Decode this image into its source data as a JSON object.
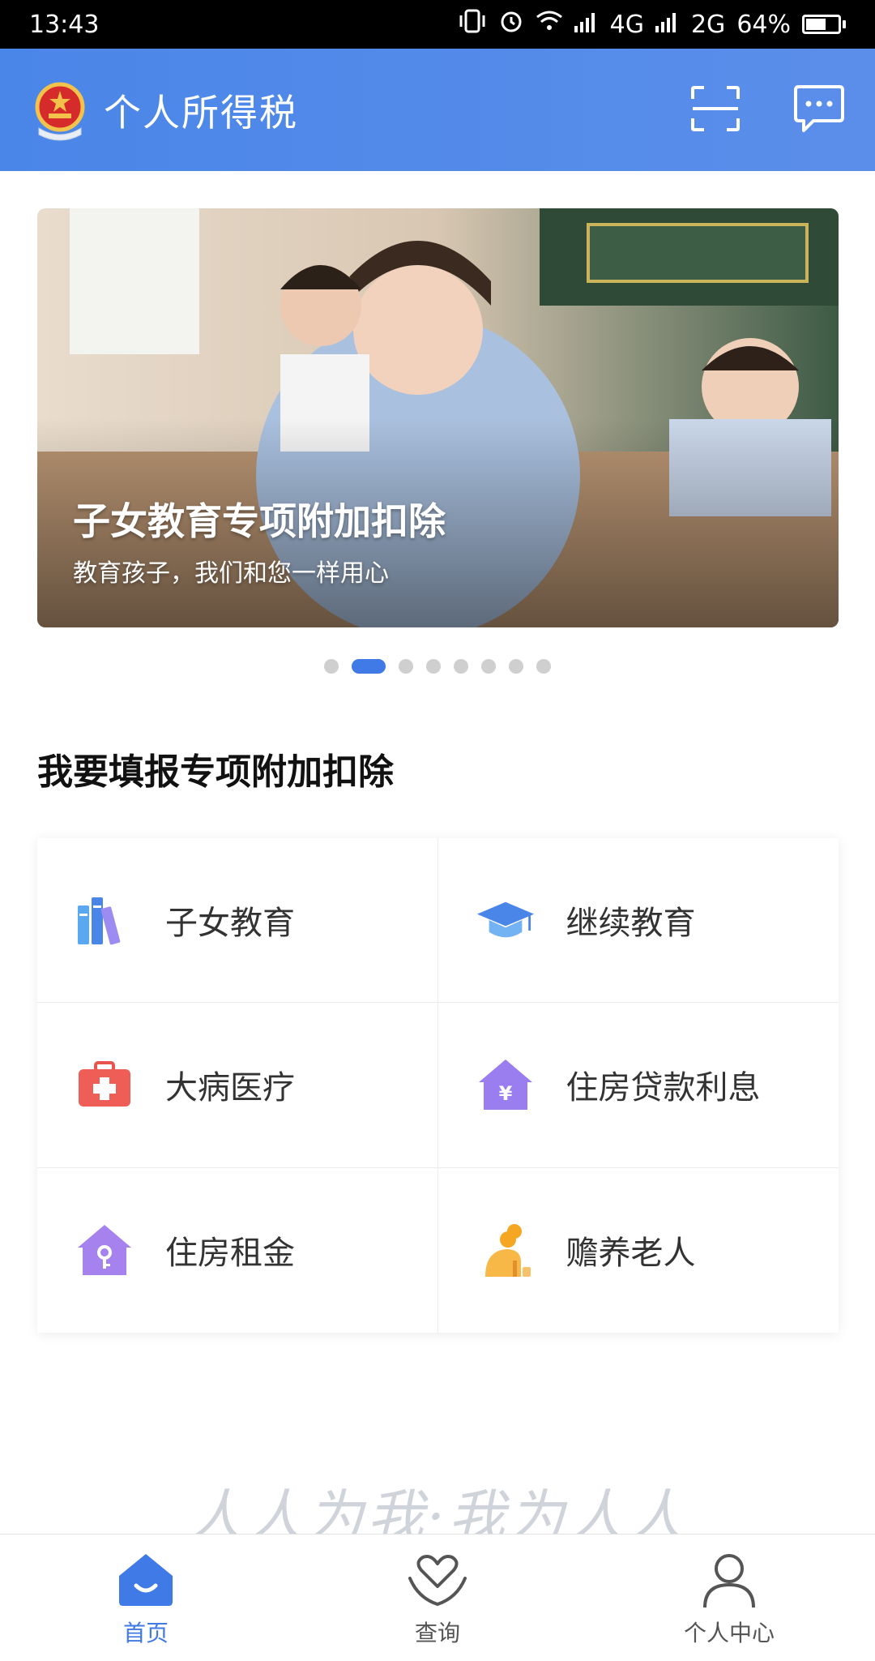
{
  "status_bar": {
    "time": "13:43",
    "network1": "4G",
    "network2": "2G",
    "battery": "64%",
    "battery_level": 0.64
  },
  "header": {
    "title": "个人所得税",
    "logo_icon": "national-emblem-icon",
    "scan_icon": "scan-icon",
    "message_icon": "message-icon"
  },
  "banner": {
    "title": "子女教育专项附加扣除",
    "subtitle": "教育孩子，我们和您一样用心",
    "total_slides": 8,
    "active_slide": 2
  },
  "section": {
    "title": "我要填报专项附加扣除"
  },
  "deductions": [
    {
      "label": "子女教育",
      "icon": "books-icon"
    },
    {
      "label": "继续教育",
      "icon": "graduation-cap-icon"
    },
    {
      "label": "大病医疗",
      "icon": "medical-kit-icon"
    },
    {
      "label": "住房贷款利息",
      "icon": "house-yuan-icon"
    },
    {
      "label": "住房租金",
      "icon": "house-key-icon"
    },
    {
      "label": "赡养老人",
      "icon": "elderly-person-icon"
    }
  ],
  "slogan": "人人为我·我为人人",
  "bottom_nav": [
    {
      "label": "首页",
      "icon": "home-icon",
      "active": true
    },
    {
      "label": "查询",
      "icon": "heart-hand-icon",
      "active": false
    },
    {
      "label": "个人中心",
      "icon": "person-icon",
      "active": false
    }
  ],
  "colors": {
    "primary": "#3f7ae6",
    "header": "#4a86e8",
    "slogan": "#cfd3da"
  }
}
